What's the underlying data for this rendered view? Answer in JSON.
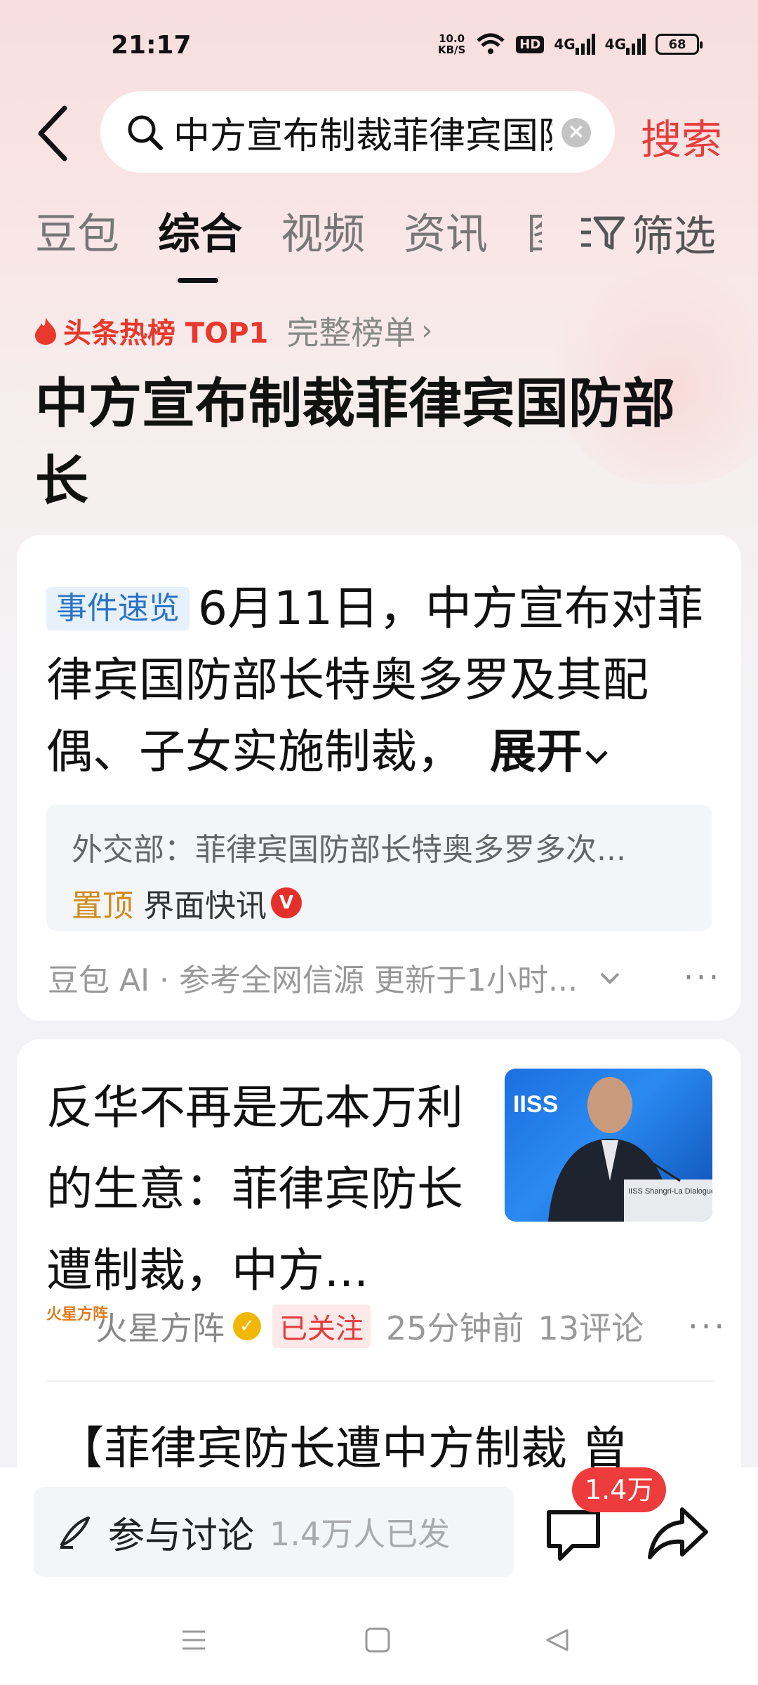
{
  "status_bar": {
    "time": "21:17",
    "net_speed_value": "10.0",
    "net_speed_unit": "KB/S",
    "hd": "HD",
    "signal1": "4G",
    "signal2": "4G",
    "battery": "68"
  },
  "search": {
    "query": "中方宣布制裁菲律宾国防部长",
    "submit_label": "搜索"
  },
  "tabs": [
    "豆包",
    "综合",
    "视频",
    "资讯",
    "图"
  ],
  "active_tab": "综合",
  "filter_label": "筛选",
  "hot_rank": {
    "label": "头条热榜 TOP1",
    "more": "完整榜单"
  },
  "headline": "中方宣布制裁菲律宾国防部长",
  "event_card": {
    "tag": "事件速览",
    "summary": "6月11日，中方宣布对菲律宾国防部长特奥多罗及其配偶、子女实施制裁，",
    "expand": "展开",
    "quote_text": "外交部：菲律宾国防部长特奥多罗多次...",
    "quote_pin": "置顶",
    "quote_source": "界面快讯",
    "quote_badge": "V",
    "footer": "豆包 AI · 参考全网信源 更新于1小时..."
  },
  "article1": {
    "title": "反华不再是无本万利的生意：菲律宾防长遭制裁，中方...",
    "thumb_banner": "IISS Shangri-La Dialogue",
    "thumb_text": "IISS",
    "logo_text": "火星方阵",
    "author": "火星方阵",
    "follow_status": "已关注",
    "time": "25分钟前",
    "comments": "13评论"
  },
  "article2": {
    "title": "【菲律宾防长遭中方制裁 曾"
  },
  "bottom_bar": {
    "discuss_label": "参与讨论",
    "discuss_count": "1.4万人已发",
    "comment_badge": "1.4万"
  },
  "colors": {
    "accent": "#e63d3d",
    "tag_blue": "#2a73c5",
    "pin_gold": "#d08a1d"
  }
}
